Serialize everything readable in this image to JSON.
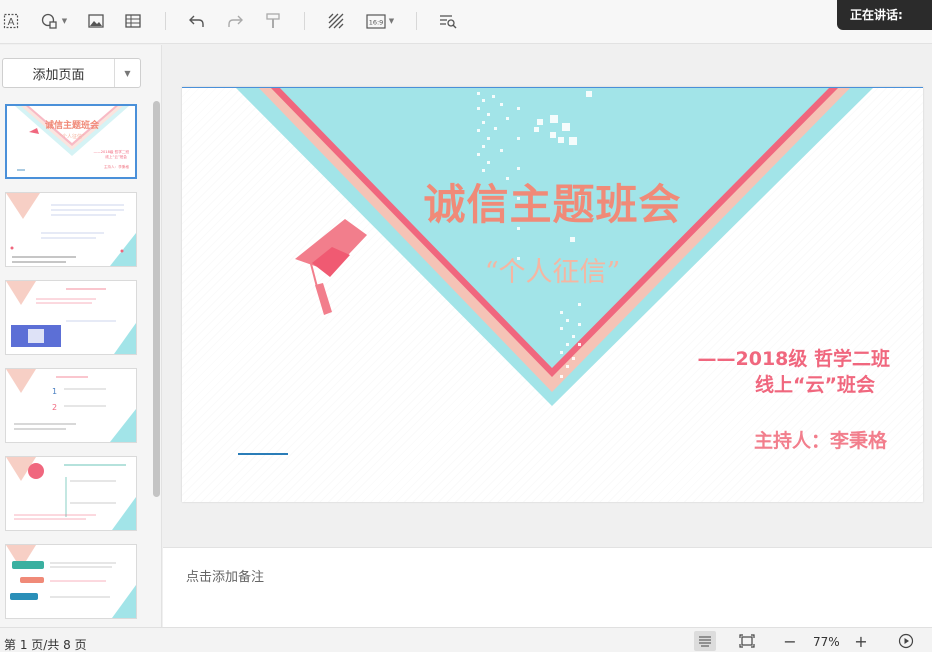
{
  "toolbar": {
    "icons": [
      "text-box-icon",
      "shape-icon",
      "image-icon",
      "table-icon",
      "undo-icon",
      "redo-icon",
      "format-painter-icon",
      "background-pattern-icon",
      "aspect-ratio-icon",
      "search-text-icon"
    ],
    "aspect_ratio_label": "16:9"
  },
  "speaker": {
    "label": "正在讲话:"
  },
  "sidebar": {
    "add_page_label": "添加页面",
    "thumbnail_count": 6,
    "active_thumbnail": 1
  },
  "slide": {
    "title": "诚信主题班会",
    "subtitle": "“个人征信”",
    "class_line1": "——2018级 哲学二班",
    "class_line2": "线上“云”班会",
    "host": "主持人：李秉格",
    "colors": {
      "pink": "#f0677e",
      "salmon": "#f5c3b6",
      "aqua": "#a2e4e8",
      "title": "#f08a78"
    }
  },
  "notes": {
    "placeholder": "点击添加备注"
  },
  "status": {
    "page_info": "第 1 页/共 8 页",
    "zoom": "77%",
    "icons": [
      "notes-toggle-icon",
      "fit-screen-icon",
      "zoom-out-icon",
      "zoom-in-icon",
      "play-icon"
    ]
  }
}
